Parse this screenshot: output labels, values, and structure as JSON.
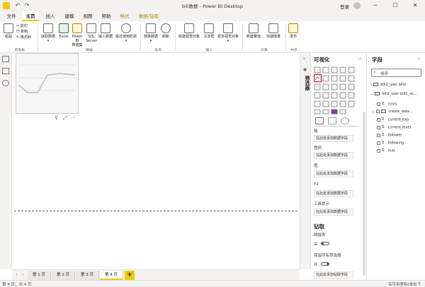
{
  "window": {
    "title": "bili数据 - Power BI Desktop",
    "sign_in": "登录",
    "undo": "↶",
    "redo": "↷",
    "minimize": "─",
    "maximize": "☐",
    "close": "✕"
  },
  "tabs": [
    "文件",
    "主页",
    "插入",
    "建模",
    "视图",
    "帮助",
    "格式",
    "数据/钻取"
  ],
  "active_tab": "主页",
  "ribbon": {
    "clipboard": {
      "paste": "粘贴",
      "cut": "剪切",
      "copy": "复制",
      "format_painter": "格式刷",
      "group_label": "剪贴板"
    },
    "data": {
      "get_data": "获取数据",
      "excel": "Excel",
      "pbi_datasets": [
        "Power BI",
        "数据集"
      ],
      "sql": [
        "SQL",
        "Server"
      ],
      "enter_data": "输入数据",
      "recent_sources": "最近使用的源",
      "group_label": "数据"
    },
    "queries": {
      "transform": "转换数据",
      "refresh": "刷新",
      "group_label": "查询"
    },
    "insert": {
      "new_visual": "新建视觉对象",
      "text_box": "文本框",
      "more_visuals": "更多视觉对象",
      "group_label": "插入"
    },
    "calculations": {
      "new_measure": "新建量值",
      "quick_measure": "快速度量",
      "group_label": "计算"
    },
    "share": {
      "publish": "发布",
      "group_label": "共享"
    }
  },
  "canvas": {
    "visual_controls": {
      "filter": "⊽",
      "focus": "⤢",
      "more": "···"
    }
  },
  "pages": {
    "tabs": [
      "第 1 页",
      "第 2 页",
      "第 3 页",
      "第 4 页"
    ],
    "active": "第 4 页",
    "add": "+"
  },
  "status": {
    "left": "第 4 页，共 4 页",
    "right": "有可用更新(单击下载)"
  },
  "filters_pane": {
    "label": "筛选器"
  },
  "visualizations": {
    "title": "可视化",
    "wells": [
      {
        "label": "轴",
        "placeholder": "在此处添加数据字段"
      },
      {
        "label": "图例",
        "placeholder": "在此处添加数据字段"
      },
      {
        "label": "值",
        "placeholder": "在此处添加数据字段"
      },
      {
        "label": "Y2",
        "placeholder": "在此处添加数据字段"
      },
      {
        "label": "工具提示",
        "placeholder": "在此处添加数据字段"
      }
    ],
    "drillthrough": {
      "title": "钻取",
      "cross_report": "跨报表",
      "cross_report_state": "关",
      "keep_filters": "保留所有筛选器",
      "keep_filters_state": "开",
      "placeholder": "在此处添加钻取字段"
    }
  },
  "fields": {
    "title": "字段",
    "search_placeholder": "搜索",
    "tables": [
      {
        "name": "bili2_user bili2",
        "expanded": false
      },
      {
        "name": "bili2_user bili2_us...",
        "expanded": true,
        "fields": [
          {
            "name": "coins",
            "type": "sigma"
          },
          {
            "name": "create_date...",
            "type": "date"
          },
          {
            "name": "current_exp",
            "type": "sigma"
          },
          {
            "name": "current_level",
            "type": "sigma"
          },
          {
            "name": "follower",
            "type": "sigma"
          },
          {
            "name": "following",
            "type": "sigma"
          },
          {
            "name": "mid",
            "type": "sigma"
          }
        ]
      }
    ]
  },
  "colors": {
    "accent": "#f2c811",
    "selected_visual_border": "#d13438",
    "excel_green": "#217346"
  }
}
